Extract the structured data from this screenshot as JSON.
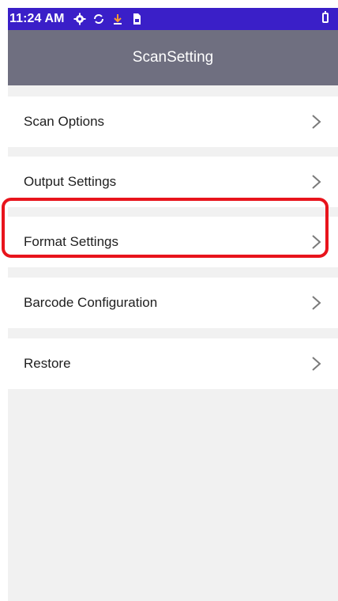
{
  "status_bar": {
    "time": "11:24 AM",
    "icons": [
      "gear-icon",
      "sync-icon",
      "download-icon",
      "sim-card-icon",
      "battery-icon"
    ]
  },
  "header": {
    "title": "ScanSetting"
  },
  "menu": {
    "items": [
      {
        "label": "Scan Options",
        "icon": "chevron-right-icon"
      },
      {
        "label": "Output Settings",
        "icon": "chevron-right-icon"
      },
      {
        "label": "Format Settings",
        "icon": "chevron-right-icon"
      },
      {
        "label": "Barcode Configuration",
        "icon": "chevron-right-icon",
        "highlighted": true
      },
      {
        "label": "Restore",
        "icon": "chevron-right-icon"
      }
    ]
  },
  "colors": {
    "status_bar": "#3a1fc8",
    "app_bar": "#6f6f80",
    "background": "#f1f1f1",
    "highlight": "#e8141c"
  }
}
